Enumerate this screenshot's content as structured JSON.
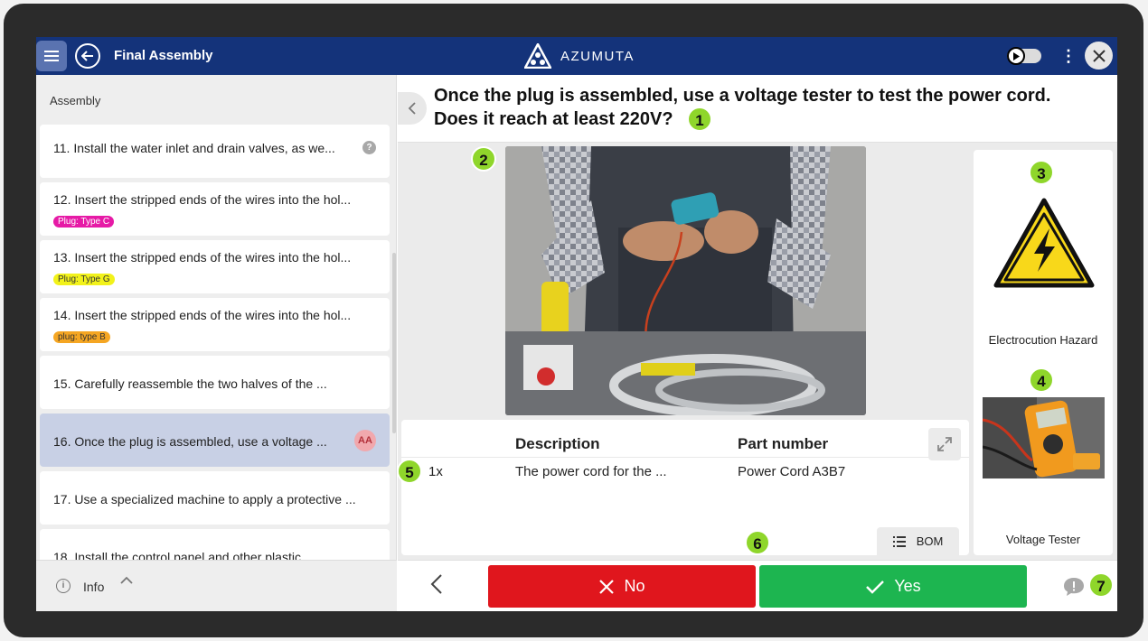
{
  "header": {
    "title": "Final Assembly",
    "brand": "AZUMUTA"
  },
  "sidebar": {
    "heading": "Assembly",
    "steps": [
      {
        "label": "11. Install the water inlet and drain valves, as we...",
        "tag": null,
        "status": "help"
      },
      {
        "label": "12. Insert the stripped ends of the wires into the hol...",
        "tag": "Plug: Type C",
        "tag_color": "#e61aa6"
      },
      {
        "label": "13. Insert the stripped ends of the wires into the hol...",
        "tag": "Plug: Type G",
        "tag_color": "#f2f21a"
      },
      {
        "label": "14. Insert the stripped ends of the wires into the hol...",
        "tag": "plug: type B",
        "tag_color": "#f5a623"
      },
      {
        "label": "15. Carefully reassemble the two halves of the ..."
      },
      {
        "label": "16. Once the plug is assembled, use a voltage ...",
        "avatar": "AA",
        "active": true
      },
      {
        "label": "17. Use a specialized machine to apply a protective ..."
      },
      {
        "label": "18. Install the control panel and other plastic ..."
      }
    ],
    "footer": {
      "info_label": "Info"
    }
  },
  "main": {
    "question_line1": "Once the plug is assembled, use a voltage tester to test the power cord.",
    "question_line2": "Does it reach at least 220V?",
    "badges": [
      "1",
      "2",
      "3",
      "4",
      "5",
      "6",
      "7"
    ],
    "hazard_label": "Electrocution Hazard",
    "tester_label": "Voltage Tester",
    "bom": {
      "headers": [
        "Description",
        "Part number"
      ],
      "rows": [
        {
          "qty": "1x",
          "description": "The power cord for the ...",
          "part_number": "Power Cord A3B7"
        }
      ],
      "button_label": "BOM"
    },
    "actions": {
      "no_label": "No",
      "yes_label": "Yes"
    }
  },
  "colors": {
    "topbar": "#14337a",
    "no": "#e0161d",
    "yes": "#1db550",
    "badge": "#8fd62b",
    "active_step": "#c8d0e5"
  }
}
